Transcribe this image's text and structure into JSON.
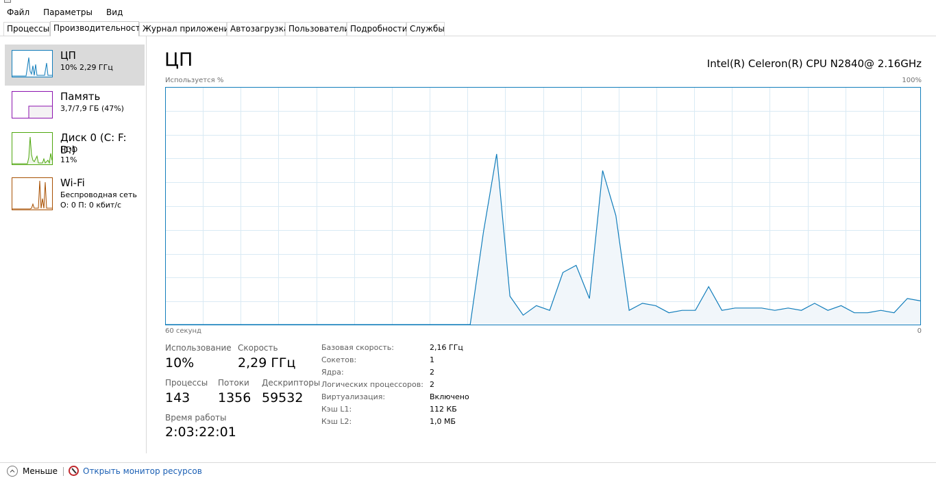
{
  "menu": [
    "Файл",
    "Параметры",
    "Вид"
  ],
  "tabs": [
    "Процессы",
    "Производительность",
    "Журнал приложений",
    "Автозагрузка",
    "Пользователи",
    "Подробности",
    "Службы"
  ],
  "active_tab": "Производительность",
  "sidebar": {
    "items": [
      {
        "title": "ЦП",
        "line1": "10% 2,29 ГГц",
        "line2": "",
        "color": "#117dbb",
        "fill": "#f1f6fa"
      },
      {
        "title": "Память",
        "line1": "3,7/7,9 ГБ (47%)",
        "line2": "",
        "color": "#8b12ae",
        "fill": "#f4f2f4"
      },
      {
        "title": "Диск 0 (C: F: D:)",
        "line1": "HDD",
        "line2": "11%",
        "color": "#4da60c",
        "fill": "#eff7e9"
      },
      {
        "title": "Wi-Fi",
        "line1": "Беспроводная сеть",
        "line2": "О: 0 П: 0 кбит/с",
        "color": "#a74f01",
        "fill": "#fcf3eb"
      }
    ]
  },
  "main": {
    "title": "ЦП",
    "cpu_name": "Intel(R) Celeron(R) CPU N2840@ 2.16GHz",
    "chart_top_left": "Используется %",
    "chart_top_right": "100%",
    "chart_bottom_left": "60 секунд",
    "chart_bottom_right": "0"
  },
  "chart_data": {
    "type": "area",
    "ylim": [
      0,
      100
    ],
    "grid": true,
    "values": [
      0,
      0,
      0,
      0,
      0,
      0,
      0,
      0,
      0,
      0,
      0,
      0,
      0,
      0,
      0,
      0,
      0,
      0,
      0,
      0,
      0,
      0,
      0,
      0,
      39,
      72,
      12,
      4,
      8,
      6,
      22,
      25,
      11,
      65,
      46,
      6,
      9,
      8,
      5,
      6,
      6,
      16,
      6,
      7,
      7,
      7,
      6,
      7,
      6,
      9,
      6,
      8,
      5,
      5,
      6,
      5,
      11,
      10
    ]
  },
  "stats": {
    "usage_label": "Использование",
    "usage_value": "10%",
    "speed_label": "Скорость",
    "speed_value": "2,29 ГГц",
    "processes_label": "Процессы",
    "processes_value": "143",
    "threads_label": "Потоки",
    "threads_value": "1356",
    "handles_label": "Дескрипторы",
    "handles_value": "59532",
    "uptime_label": "Время работы",
    "uptime_value": "2:03:22:01"
  },
  "info": [
    {
      "key": "Базовая скорость:",
      "value": "2,16 ГГц"
    },
    {
      "key": "Сокетов:",
      "value": "1"
    },
    {
      "key": "Ядра:",
      "value": "2"
    },
    {
      "key": "Логических процессоров:",
      "value": "2"
    },
    {
      "key": "Виртуализация:",
      "value": "Включено"
    },
    {
      "key": "Кэш L1:",
      "value": "112 КБ"
    },
    {
      "key": "Кэш L2:",
      "value": "1,0 МБ"
    }
  ],
  "footer": {
    "less_label": "Меньше",
    "resmon_label": "Открыть монитор ресурсов"
  }
}
